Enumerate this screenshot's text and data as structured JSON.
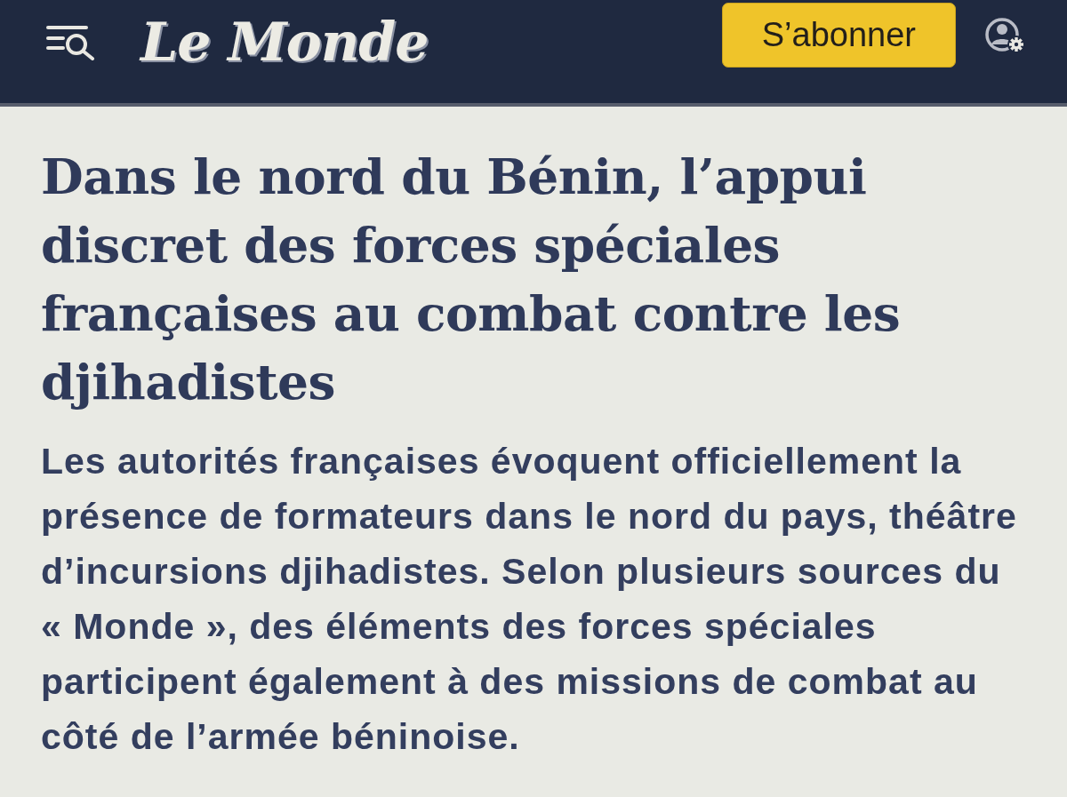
{
  "header": {
    "logo": "Le Monde",
    "subscribe_button": "S’abonner"
  },
  "article": {
    "headline": "Dans le nord du Bénin, l’appui discret des forces spéciales françaises au combat contre les djihadistes",
    "standfirst": "Les autorités françaises évoquent officiellement la présence de formateurs dans le nord du pays, théâtre d’incursions djihadistes. Selon plusieurs sources du « Monde », des éléments des forces spéciales participent également à des missions de combat au côté de l’armée béninoise."
  }
}
